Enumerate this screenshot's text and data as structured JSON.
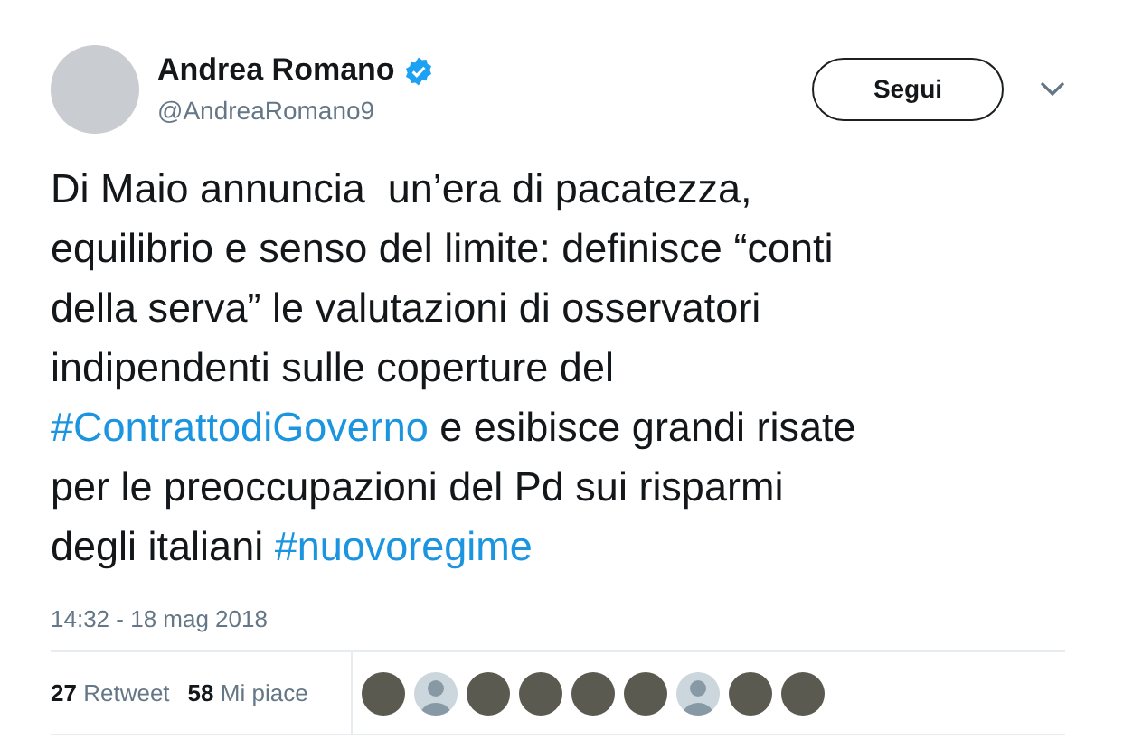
{
  "author": {
    "name": "Andrea Romano",
    "verified": true,
    "handle": "@AndreaRomano9"
  },
  "follow_button": {
    "label": "Segui"
  },
  "body": [
    [
      {
        "kind": "text",
        "text": "Di Maio annuncia  un’era di pacatezza,"
      }
    ],
    [
      {
        "kind": "text",
        "text": "equilibrio e senso del limite: definisce “conti"
      }
    ],
    [
      {
        "kind": "text",
        "text": "della serva” le valutazioni di osservatori"
      }
    ],
    [
      {
        "kind": "text",
        "text": "indipendenti sulle coperture del"
      }
    ],
    [
      {
        "kind": "hashtag",
        "text": "#ContrattodiGoverno"
      },
      {
        "kind": "text",
        "text": " e esibisce grandi risate"
      }
    ],
    [
      {
        "kind": "text",
        "text": "per le preoccupazioni del Pd sui risparmi"
      }
    ],
    [
      {
        "kind": "text",
        "text": "degli italiani "
      },
      {
        "kind": "hashtag",
        "text": "#nuovoregime"
      }
    ]
  ],
  "timestamp": "14:32 - 18 mag 2018",
  "stats": [
    {
      "count": "27",
      "label": "Retweet"
    },
    {
      "count": "58",
      "label": "Mi piace"
    }
  ],
  "likers": [
    {
      "kind": "photo"
    },
    {
      "kind": "default"
    },
    {
      "kind": "photo"
    },
    {
      "kind": "photo"
    },
    {
      "kind": "photo"
    },
    {
      "kind": "photo"
    },
    {
      "kind": "default"
    },
    {
      "kind": "photo"
    },
    {
      "kind": "photo"
    }
  ]
}
